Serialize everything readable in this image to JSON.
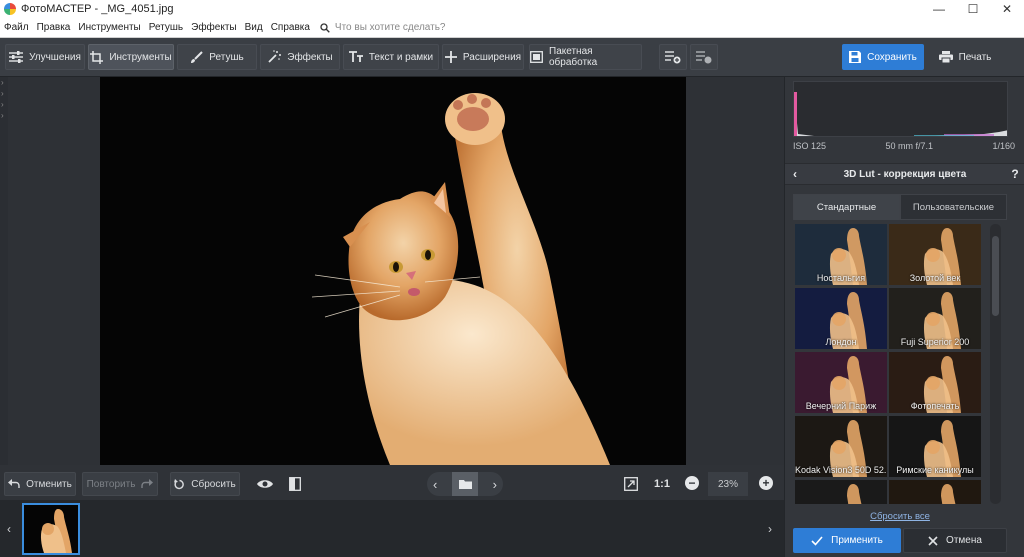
{
  "window": {
    "title": "ФотоМАСТЕР - _MG_4051.jpg",
    "minimize": "—",
    "maximize": "☐",
    "close": "✕"
  },
  "menu": {
    "items": [
      "Файл",
      "Правка",
      "Инструменты",
      "Ретушь",
      "Эффекты",
      "Вид",
      "Справка"
    ],
    "search_placeholder": "Что вы хотите сделать?"
  },
  "toolbar": {
    "tabs": [
      {
        "label": "Улучшения",
        "icon": "sliders-icon"
      },
      {
        "label": "Инструменты",
        "icon": "crop-icon"
      },
      {
        "label": "Ретушь",
        "icon": "brush-icon"
      },
      {
        "label": "Эффекты",
        "icon": "magic-wand-icon"
      },
      {
        "label": "Текст и рамки",
        "icon": "text-icon"
      },
      {
        "label": "Расширения",
        "icon": "plus-icon"
      }
    ],
    "active_tab": "Инструменты",
    "batch_label": "Пакетная обработка",
    "save_label": "Сохранить",
    "print_label": "Печать"
  },
  "bottom_bar": {
    "undo_label": "Отменить",
    "redo_label": "Повторить",
    "reset_label": "Сбросить",
    "one_to_one": "1:1",
    "zoom_value": "23%"
  },
  "panel": {
    "exif": {
      "iso": "ISO 125",
      "lens": "50 mm f/7.1",
      "shutter": "1/160"
    },
    "section_title": "3D Lut - коррекция цвета",
    "help": "?",
    "tabs": [
      "Стандартные",
      "Пользовательские"
    ],
    "active_tab": "Стандартные",
    "presets": [
      {
        "label": "Ностальгия",
        "tint": "#1e2c3c"
      },
      {
        "label": "Золотой век",
        "tint": "#3a2a18"
      },
      {
        "label": "Лондон",
        "tint": "#141c40"
      },
      {
        "label": "Fuji Superior 200",
        "tint": "#22201c"
      },
      {
        "label": "Вечерний Париж",
        "tint": "#3a1a30"
      },
      {
        "label": "Фотопечать",
        "tint": "#2a1c14"
      },
      {
        "label": "Kodak Vision3 50D 52...",
        "tint": "#1c1814"
      },
      {
        "label": "Римские каникулы",
        "tint": "#161616"
      },
      {
        "label": "",
        "tint": "#1a1a1a"
      },
      {
        "label": "",
        "tint": "#201810"
      }
    ],
    "reset_all_label": "Сбросить все",
    "apply_label": "Применить",
    "cancel_label": "Отмена"
  },
  "colors": {
    "accent": "#2e7dd6",
    "background": "#2b2e33",
    "toolbar": "#3a3e44"
  }
}
